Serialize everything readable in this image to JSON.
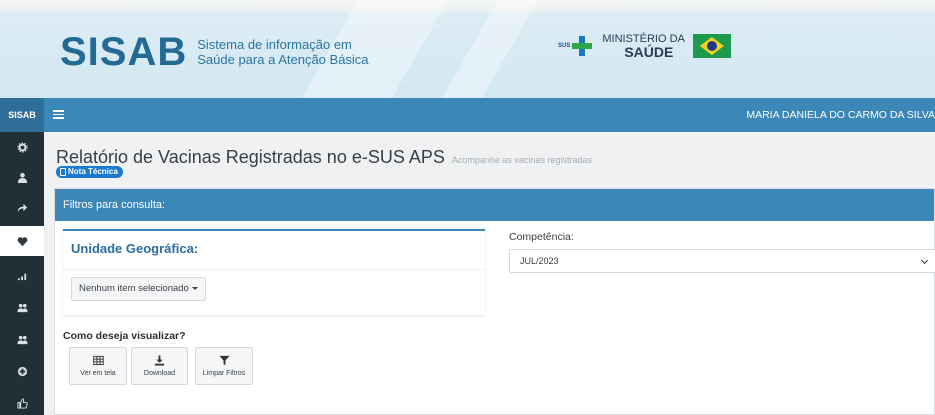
{
  "header": {
    "logo_word": "SISAB",
    "logo_sub_line1": "Sistema de informação em",
    "logo_sub_line2": "Saúde para a Atenção Básica",
    "sus_mark": "SUS",
    "ministry_line1": "MINISTÉRIO DA",
    "ministry_line2": "SAÚDE"
  },
  "navbar": {
    "brand": "SISAB",
    "username": "MARIA DANIELA DO CARMO DA SILVA"
  },
  "sidebar": {
    "items": [
      {
        "icon": "gear-icon"
      },
      {
        "icon": "user-icon"
      },
      {
        "icon": "share-icon"
      },
      {
        "icon": "heart-icon",
        "active": true
      },
      {
        "icon": "signal-bars-icon"
      },
      {
        "icon": "users-icon"
      },
      {
        "icon": "users-group-icon"
      },
      {
        "icon": "circle-plus-icon"
      },
      {
        "icon": "thumbs-up-icon"
      }
    ]
  },
  "page": {
    "title": "Relatório de Vacinas Registradas no e-SUS APS",
    "subtitle": "Acompanhe as vacinas registradas",
    "nota_tecnica": "Nota Técnica"
  },
  "filters": {
    "header": "Filtros para consulta:",
    "geo_title": "Unidade Geográfica:",
    "geo_dropdown": "Nenhum item selecionado",
    "competencia_label": "Competência:",
    "competencia_value": "JUL/2023",
    "visualizar_label": "Como deseja visualizar?",
    "buttons": {
      "ver_em_tela": "Ver em tela",
      "download": "Download",
      "limpar_filtros": "Limpar Filtros"
    }
  },
  "colors": {
    "primary": "#3a87b8",
    "sidebar": "#212f37",
    "logo": "#236a94",
    "badge": "#1b7ad0"
  }
}
